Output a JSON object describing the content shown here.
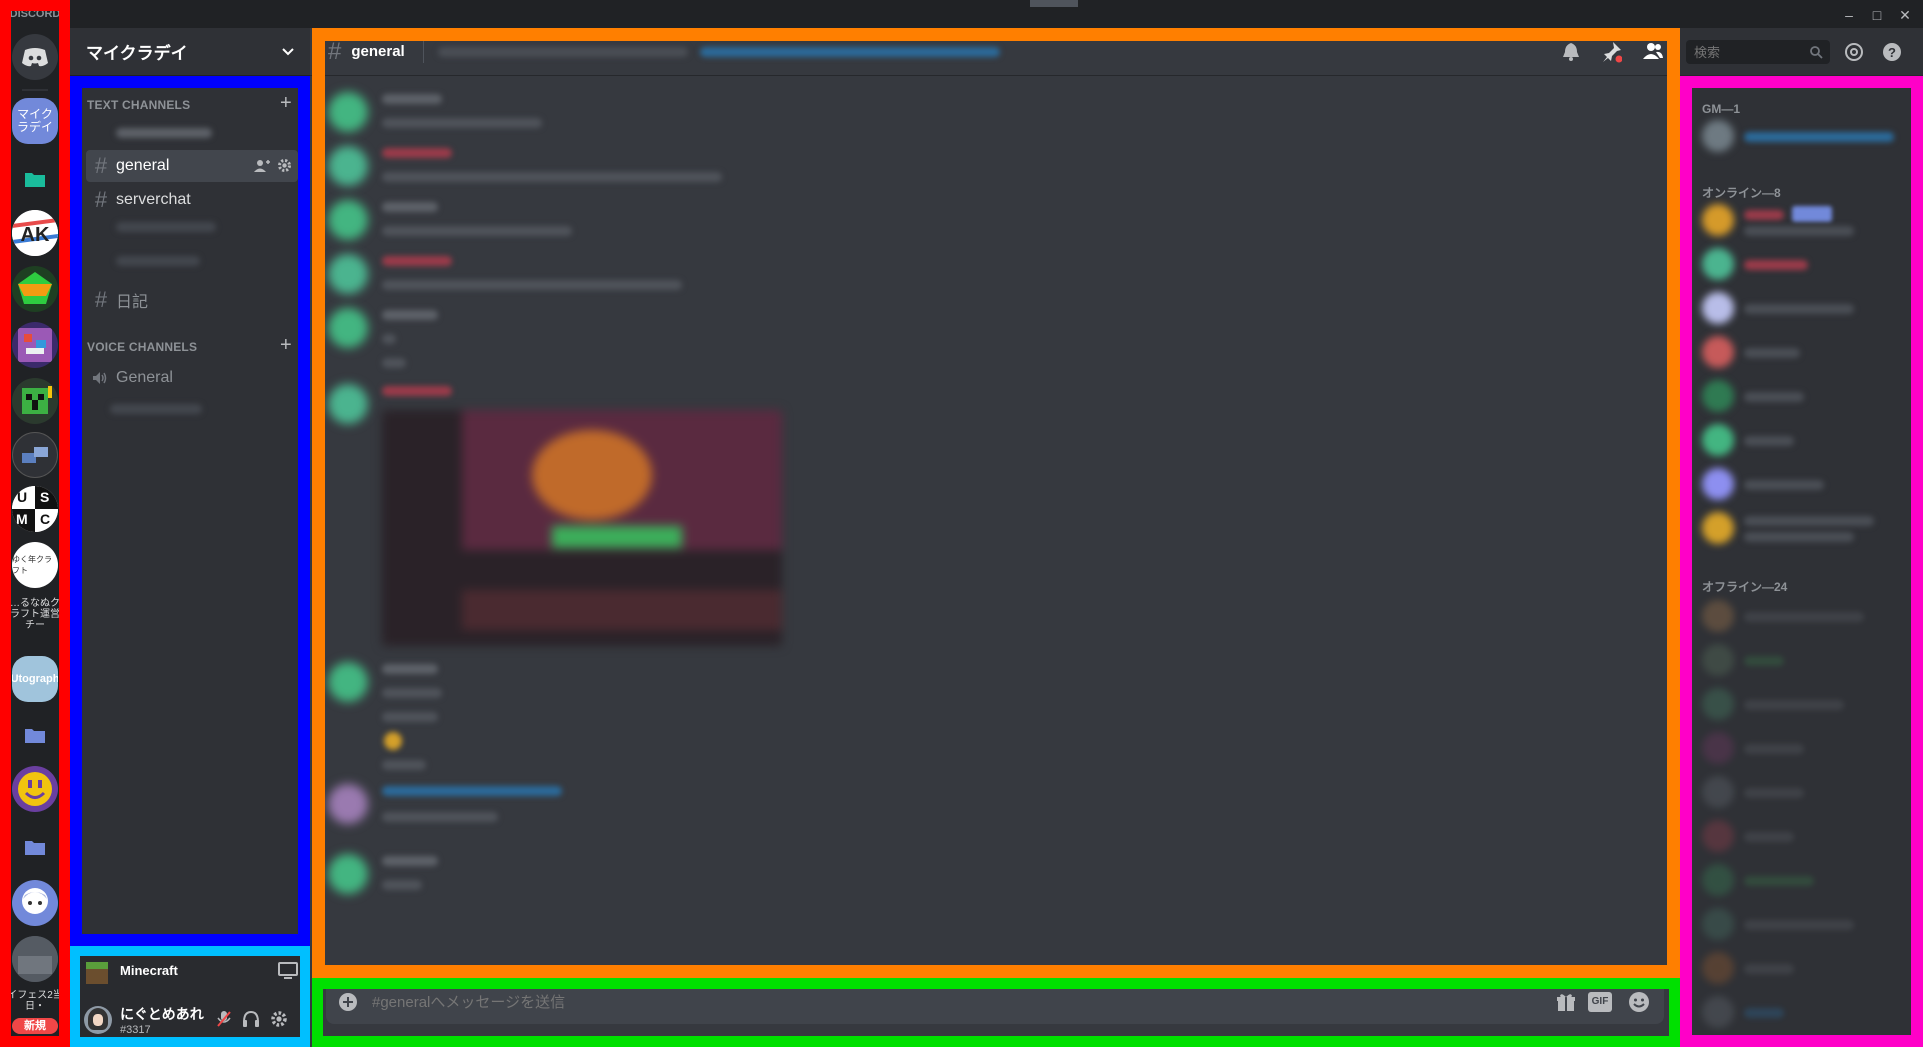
{
  "window": {
    "app_label": "DISCORD",
    "controls": {
      "minimize": "–",
      "maximize": "□",
      "close": "✕"
    }
  },
  "servers": {
    "active_server_short": "マイクラデイ",
    "label_1": "…るなぬクラフト運営チー",
    "logo_utograph": "Utograph",
    "label_2": "イフェス2当日・",
    "new_badge": "新規",
    "logo_usmc": [
      "U",
      "S",
      "M",
      "C"
    ],
    "logo_minecraft_club": "ゆく年クラフト"
  },
  "sidebar": {
    "guild_name": "マイクラデイ",
    "text_category": "TEXT CHANNELS",
    "voice_category": "VOICE CHANNELS",
    "text_channels": [
      {
        "name": "general",
        "selected": true
      },
      {
        "name": "serverchat",
        "selected": false
      },
      {
        "name": "日記",
        "selected": false
      }
    ],
    "voice_channels": [
      {
        "name": "General"
      }
    ]
  },
  "user_panel": {
    "activity": "Minecraft",
    "username": "にぐとめあれ",
    "discriminator": "#3317"
  },
  "chat": {
    "channel_name": "general",
    "composer_placeholder": "#generalへメッセージを送信",
    "gif_label": "GIF"
  },
  "members": {
    "search_placeholder": "検索",
    "role_group": "GM—1",
    "online_group": "オンライン—8",
    "offline_group": "オフライン—24"
  },
  "colors": {
    "rail": "#202225",
    "sidebar": "#2f3136",
    "chat_bg": "#36393f",
    "frame_rail": "#ff0000",
    "frame_sidebar": "#0000ff",
    "frame_userpanel": "#00bfff",
    "frame_chat": "#ff7f00",
    "frame_composer": "#00e000",
    "frame_members": "#ff00c8"
  }
}
